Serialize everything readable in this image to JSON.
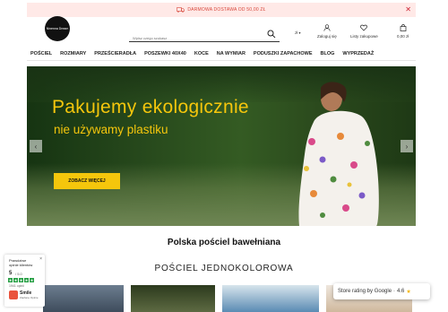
{
  "topbar": {
    "message": "DARMOWA DOSTAWA od 50,00 zł",
    "close": "✕"
  },
  "logo": {
    "text": "Ninenna Dream"
  },
  "search": {
    "placeholder": "Wpisz czego szukasz"
  },
  "header": {
    "currency": "zł",
    "login_label": "Zaloguj się",
    "wishlist_label": "Listy zakupowe",
    "cart_label": "0,00 zł"
  },
  "nav": [
    "POŚCIEL",
    "ROZMIARY",
    "PRZEŚCIERADŁA",
    "POSZEWKI 40X40",
    "KOCE",
    "NA WYMIAR",
    "PODUSZKI ZAPACHOWE",
    "BLOG",
    "WYPRZEDAŻ"
  ],
  "hero": {
    "title": "Pakujemy ekologicznie",
    "subtitle": "nie używamy plastiku",
    "cta": "ZOBACZ WIĘCEJ",
    "prev": "‹",
    "next": "›"
  },
  "sections": {
    "title": "Polska pościel bawełniana",
    "subtitle": "POŚCIEL JEDNOKOLOROWA"
  },
  "badge": {
    "title_line1": "Prawdziwe",
    "title_line2": "opinie klientów",
    "close": "×",
    "score": "5",
    "scale": "/ 5.0",
    "count": "1941 opinii",
    "brand": "Smile",
    "brand_sub": "Zaufane Opinie"
  },
  "google": {
    "label": "Store rating by Google",
    "rating": "4.6"
  },
  "colors": {
    "accent": "#f5c60c",
    "promo_bg": "#ffe9e7",
    "promo_text": "#d7463a"
  }
}
